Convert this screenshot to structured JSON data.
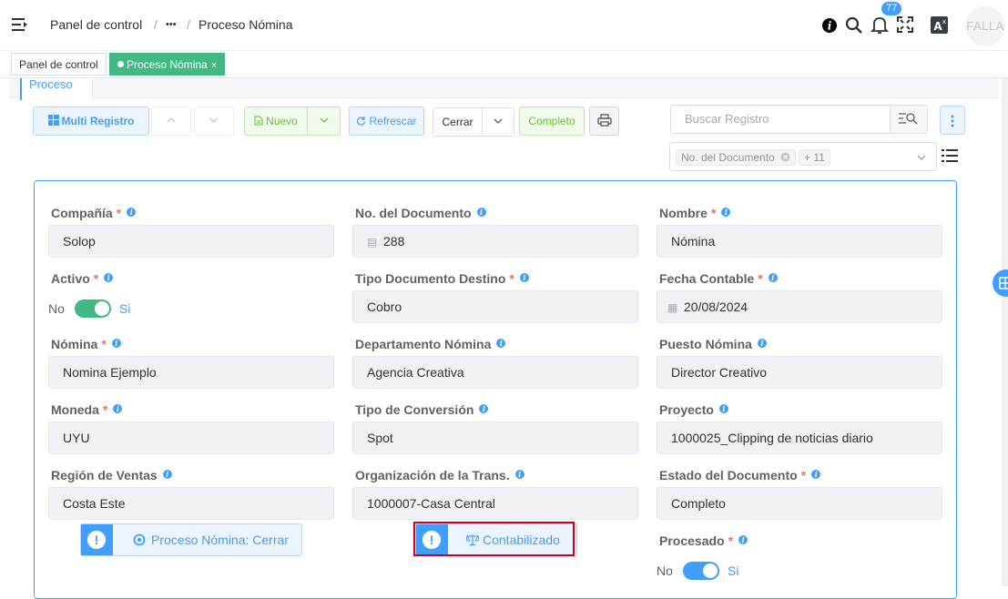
{
  "header": {
    "breadcrumb_home": "Panel de control",
    "breadcrumb_sep": "/",
    "breadcrumb_ellipsis": "•••",
    "breadcrumb_current": "Proceso Nómina",
    "notifications_count": "77",
    "avatar_text": "FALLA"
  },
  "tags": {
    "home": "Panel de control",
    "current": "Proceso Nómina",
    "close": "×"
  },
  "tab": {
    "label": "Proceso"
  },
  "toolbar": {
    "multi_registro": "Multi Registro",
    "nuevo": "Nuevo",
    "refrescar": "Refrescar",
    "cerrar": "Cerrar",
    "completo": "Completo"
  },
  "search": {
    "placeholder": "Buscar Registro",
    "selected_chip": "No. del Documento",
    "extra_count": "+ 11"
  },
  "form": {
    "compania": {
      "label": "Compañía",
      "value": "Solop"
    },
    "no_documento": {
      "label": "No. del Documento",
      "value": "288"
    },
    "nombre": {
      "label": "Nombre",
      "value": "Nómina"
    },
    "activo": {
      "label": "Activo",
      "off": "No",
      "on": "Si",
      "state": true
    },
    "tipo_doc_destino": {
      "label": "Tipo Documento Destino",
      "value": "Cobro"
    },
    "fecha_contable": {
      "label": "Fecha Contable",
      "value": "20/08/2024"
    },
    "nomina": {
      "label": "Nómina",
      "value": "Nomina Ejemplo"
    },
    "departamento": {
      "label": "Departamento Nómina",
      "value": "Agencia Creativa"
    },
    "puesto": {
      "label": "Puesto Nómina",
      "value": "Director Creativo"
    },
    "moneda": {
      "label": "Moneda",
      "value": "UYU"
    },
    "tipo_conversion": {
      "label": "Tipo de Conversión",
      "value": "Spot"
    },
    "proyecto": {
      "label": "Proyecto",
      "value": "1000025_Clipping de noticias diario"
    },
    "region": {
      "label": "Región de Ventas",
      "value": "Costa Este"
    },
    "organizacion": {
      "label": "Organización de la Trans.",
      "value": "1000007-Casa Central"
    },
    "estado": {
      "label": "Estado del Documento",
      "value": "Completo"
    },
    "procesado": {
      "label": "Procesado",
      "off": "No",
      "on": "Si",
      "state": true
    },
    "btn_proceso_cerrar": "Proceso Nómina: Cerrar",
    "btn_contabilizado": "Contabilizado"
  },
  "colors": {
    "primary": "#409eff",
    "success": "#42b983",
    "required": "#f56c6c",
    "highlight_frame": "#d0021b"
  }
}
